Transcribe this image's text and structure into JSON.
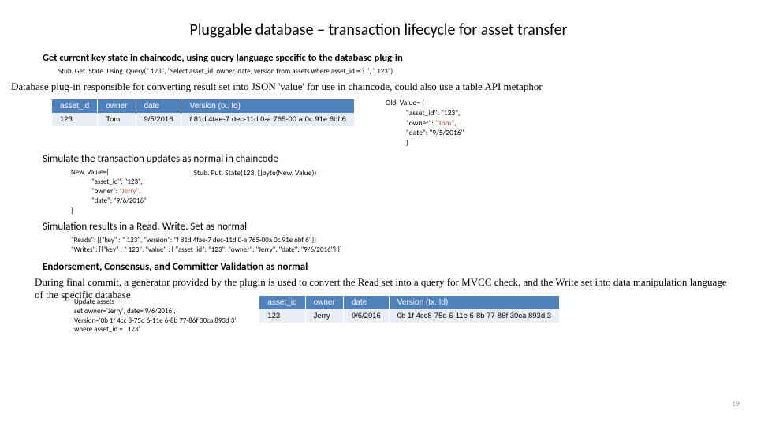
{
  "title": "Pluggable database – transaction lifecycle for asset transfer",
  "s1": "Get current key state in chaincode, using query language specific to the database plug-in",
  "stubget": "Stub. Get. State. Using. Query(\" 123\", \"Select asset_id, owner, date, version from assets where asset_id = ? \", \" 123\")",
  "s2": "Database plug-in responsible for converting result set into JSON 'value' for use in chaincode, could also use a table API metaphor",
  "table1": {
    "headers": [
      "asset_id",
      "owner",
      "date",
      "Version (tx. Id)"
    ],
    "row": [
      "123",
      "Tom",
      "9/5/2016",
      "f 81d 4fae-7 dec-11d 0-a 765-00 a 0c 91e 6bf 6"
    ]
  },
  "oldval": {
    "l1": "Old. Value= {",
    "l2": "\"asset_id\": \"123\",",
    "l3a": "\"owner\": ",
    "l3b": "\"Tom\"",
    "l3c": ",",
    "l4": "\"date\": \"9/5/2016\"",
    "l5": "}"
  },
  "simline": "Simulate the transaction updates as normal in chaincode",
  "newval": {
    "l1": "New. Value={",
    "l2": "\"asset_id\": \"123\",",
    "l3a": "\"owner\": ",
    "l3b": "\"Jerry\"",
    "l3c": ",",
    "l4": "\"date\": \"9/6/2016\"",
    "l5": "}"
  },
  "stubput": "Stub. Put. State(123, []byte(New. Value))",
  "resultline": "Simulation results in a Read. Write. Set as normal",
  "rw": {
    "r": "\"Reads\": [{\"key\" : \" 123\", \"version\": \"f 81d 4fae-7 dec-11d 0-a 765-00a 0c 91e 6bf 6\"}]",
    "w": "\"Writes\": [{\"key\" : \" 123\", \"value\" : { \"asset_id\": \"123\", \"owner\": \"Jerry\", \"date\": \"9/6/2016\"} }]"
  },
  "endorse": "Endorsement, Consensus, and Committer Validation as normal",
  "final": "During final commit, a generator provided by the plugin is used to convert the Read set into a query for MVCC check, and the Write set into data manipulation language of the specific database",
  "update": {
    "l1": "Update assets",
    "l2": "set owner='Jerry', date='9/6/2016',",
    "l3": "Version='0b 1f 4cc 8-75d 6-11e 6-8b 77-86f 30ca 893d 3'",
    "l4": "where asset_id = ' 123'"
  },
  "table2": {
    "headers": [
      "asset_id",
      "owner",
      "date",
      "Version (tx. Id)"
    ],
    "row": [
      "123",
      "Jerry",
      "9/6/2016",
      "0b 1f 4cc8-75d 6-11e 6-8b 77-86f 30ca 893d 3"
    ]
  },
  "pagenum": "19"
}
